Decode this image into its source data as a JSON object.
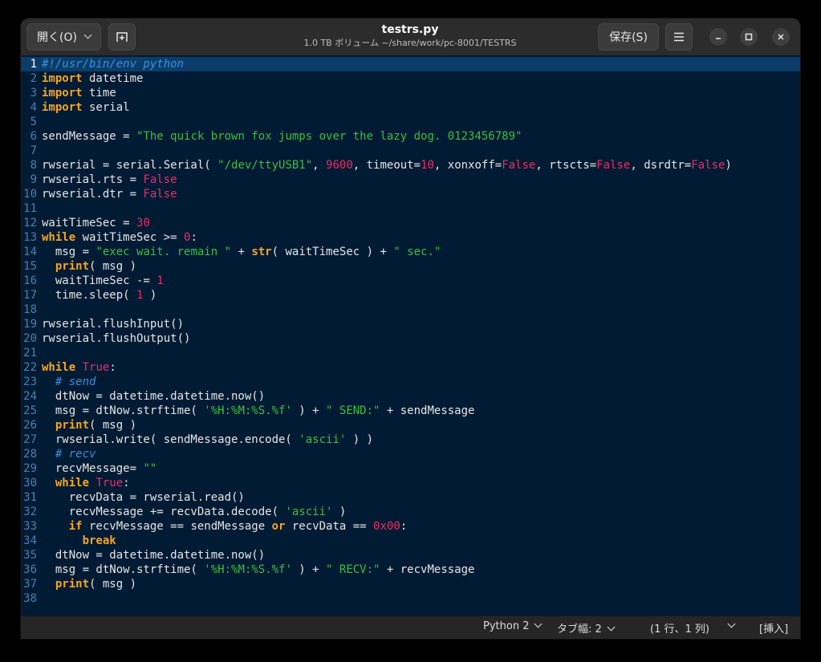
{
  "header": {
    "open_label": "開く(O)",
    "title": "testrs.py",
    "subtitle": "1.0 TB ボリューム ~/share/work/pc-8001/TESTRS",
    "save_label": "保存(S)"
  },
  "editor": {
    "current_line": 1,
    "lines": [
      [
        [
          "cm",
          "#!/usr/bin/env python"
        ]
      ],
      [
        [
          "kw",
          "import"
        ],
        [
          "t",
          " datetime"
        ]
      ],
      [
        [
          "kw",
          "import"
        ],
        [
          "t",
          " time"
        ]
      ],
      [
        [
          "kw",
          "import"
        ],
        [
          "t",
          " serial"
        ]
      ],
      [],
      [
        [
          "t",
          "sendMessage = "
        ],
        [
          "str",
          "\"The quick brown fox jumps over the lazy dog. 0123456789\""
        ]
      ],
      [],
      [
        [
          "t",
          "rwserial = serial.Serial( "
        ],
        [
          "str",
          "\"/dev/ttyUSB1\""
        ],
        [
          "t",
          ", "
        ],
        [
          "num",
          "9600"
        ],
        [
          "t",
          ", timeout="
        ],
        [
          "num",
          "10"
        ],
        [
          "t",
          ", xonxoff="
        ],
        [
          "num",
          "False"
        ],
        [
          "t",
          ", rtscts="
        ],
        [
          "num",
          "False"
        ],
        [
          "t",
          ", dsrdtr="
        ],
        [
          "num",
          "False"
        ],
        [
          "t",
          ")"
        ]
      ],
      [
        [
          "t",
          "rwserial.rts = "
        ],
        [
          "num",
          "False"
        ]
      ],
      [
        [
          "t",
          "rwserial.dtr = "
        ],
        [
          "num",
          "False"
        ]
      ],
      [],
      [
        [
          "t",
          "waitTimeSec = "
        ],
        [
          "num",
          "30"
        ]
      ],
      [
        [
          "kw",
          "while"
        ],
        [
          "t",
          " waitTimeSec >= "
        ],
        [
          "num",
          "0"
        ],
        [
          "t",
          ":"
        ]
      ],
      [
        [
          "t",
          "  msg = "
        ],
        [
          "str",
          "\"exec wait. remain \""
        ],
        [
          "t",
          " + "
        ],
        [
          "kw",
          "str"
        ],
        [
          "t",
          "( waitTimeSec ) + "
        ],
        [
          "str",
          "\" sec.\""
        ]
      ],
      [
        [
          "t",
          "  "
        ],
        [
          "kw",
          "print"
        ],
        [
          "t",
          "( msg )"
        ]
      ],
      [
        [
          "t",
          "  waitTimeSec -= "
        ],
        [
          "num",
          "1"
        ]
      ],
      [
        [
          "t",
          "  time.sleep( "
        ],
        [
          "num",
          "1"
        ],
        [
          "t",
          " )"
        ]
      ],
      [],
      [
        [
          "t",
          "rwserial.flushInput()"
        ]
      ],
      [
        [
          "t",
          "rwserial.flushOutput()"
        ]
      ],
      [],
      [
        [
          "kw",
          "while"
        ],
        [
          "t",
          " "
        ],
        [
          "num",
          "True"
        ],
        [
          "t",
          ":"
        ]
      ],
      [
        [
          "t",
          "  "
        ],
        [
          "cm",
          "# send"
        ]
      ],
      [
        [
          "t",
          "  dtNow = datetime.datetime.now()"
        ]
      ],
      [
        [
          "t",
          "  msg = dtNow.strftime( "
        ],
        [
          "str",
          "'%H:%M:%S.%f'"
        ],
        [
          "t",
          " ) + "
        ],
        [
          "str",
          "\" SEND:\""
        ],
        [
          "t",
          " + sendMessage"
        ]
      ],
      [
        [
          "t",
          "  "
        ],
        [
          "kw",
          "print"
        ],
        [
          "t",
          "( msg )"
        ]
      ],
      [
        [
          "t",
          "  rwserial.write( sendMessage.encode( "
        ],
        [
          "str",
          "'ascii'"
        ],
        [
          "t",
          " ) )"
        ]
      ],
      [
        [
          "t",
          "  "
        ],
        [
          "cm",
          "# recv"
        ]
      ],
      [
        [
          "t",
          "  recvMessage= "
        ],
        [
          "str",
          "\"\""
        ]
      ],
      [
        [
          "t",
          "  "
        ],
        [
          "kw",
          "while"
        ],
        [
          "t",
          " "
        ],
        [
          "num",
          "True"
        ],
        [
          "t",
          ":"
        ]
      ],
      [
        [
          "t",
          "    recvData = rwserial.read()"
        ]
      ],
      [
        [
          "t",
          "    recvMessage += recvData.decode( "
        ],
        [
          "str",
          "'ascii'"
        ],
        [
          "t",
          " )"
        ]
      ],
      [
        [
          "t",
          "    "
        ],
        [
          "kw",
          "if"
        ],
        [
          "t",
          " recvMessage == sendMessage "
        ],
        [
          "kw",
          "or"
        ],
        [
          "t",
          " recvData == "
        ],
        [
          "num",
          "0x00"
        ],
        [
          "t",
          ":"
        ]
      ],
      [
        [
          "t",
          "      "
        ],
        [
          "kw",
          "break"
        ]
      ],
      [
        [
          "t",
          "  dtNow = datetime.datetime.now()"
        ]
      ],
      [
        [
          "t",
          "  msg = dtNow.strftime( "
        ],
        [
          "str",
          "'%H:%M:%S.%f'"
        ],
        [
          "t",
          " ) + "
        ],
        [
          "str",
          "\" RECV:\""
        ],
        [
          "t",
          " + recvMessage"
        ]
      ],
      [
        [
          "t",
          "  "
        ],
        [
          "kw",
          "print"
        ],
        [
          "t",
          "( msg )"
        ]
      ],
      []
    ]
  },
  "statusbar": {
    "language": "Python 2",
    "tab_width": "タブ幅: 2",
    "position": "(1 行、1 列)",
    "mode": "[挿入]"
  }
}
